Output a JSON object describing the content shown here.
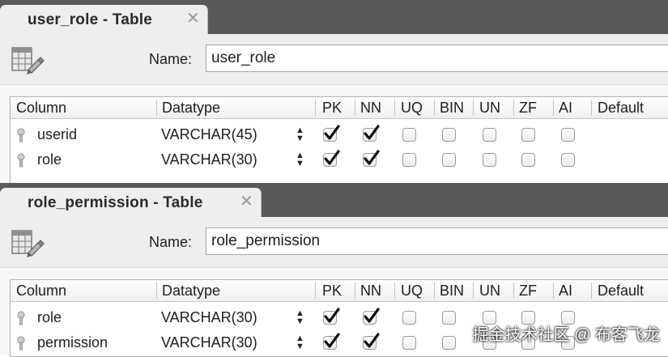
{
  "panels": [
    {
      "tab_title": "user_role - Table",
      "close_glyph": "✕",
      "name_label": "Name:",
      "name_value": "user_role",
      "headers": [
        "Column",
        "Datatype",
        "PK",
        "NN",
        "UQ",
        "BIN",
        "UN",
        "ZF",
        "AI",
        "Default"
      ],
      "rows": [
        {
          "column": "userid",
          "datatype": "VARCHAR(45)",
          "flags": [
            true,
            true,
            false,
            false,
            false,
            false,
            false
          ]
        },
        {
          "column": "role",
          "datatype": "VARCHAR(30)",
          "flags": [
            true,
            true,
            false,
            false,
            false,
            false,
            false
          ]
        }
      ]
    },
    {
      "tab_title": "role_permission - Table",
      "close_glyph": "✕",
      "name_label": "Name:",
      "name_value": "role_permission",
      "headers": [
        "Column",
        "Datatype",
        "PK",
        "NN",
        "UQ",
        "BIN",
        "UN",
        "ZF",
        "AI",
        "Default"
      ],
      "rows": [
        {
          "column": "role",
          "datatype": "VARCHAR(30)",
          "flags": [
            true,
            true,
            false,
            false,
            false,
            false,
            false
          ]
        },
        {
          "column": "permission",
          "datatype": "VARCHAR(30)",
          "flags": [
            true,
            true,
            false,
            false,
            false,
            false,
            false
          ]
        }
      ]
    }
  ],
  "watermark": "掘金技术社区 @ 布客飞龙",
  "icons": {
    "table": "table-icon",
    "key": "key-icon",
    "stepper": "stepper-icon",
    "close": "close-icon"
  },
  "colors": {
    "tabbar": "#595959",
    "panel": "#eeeeee",
    "check": "#111111"
  }
}
